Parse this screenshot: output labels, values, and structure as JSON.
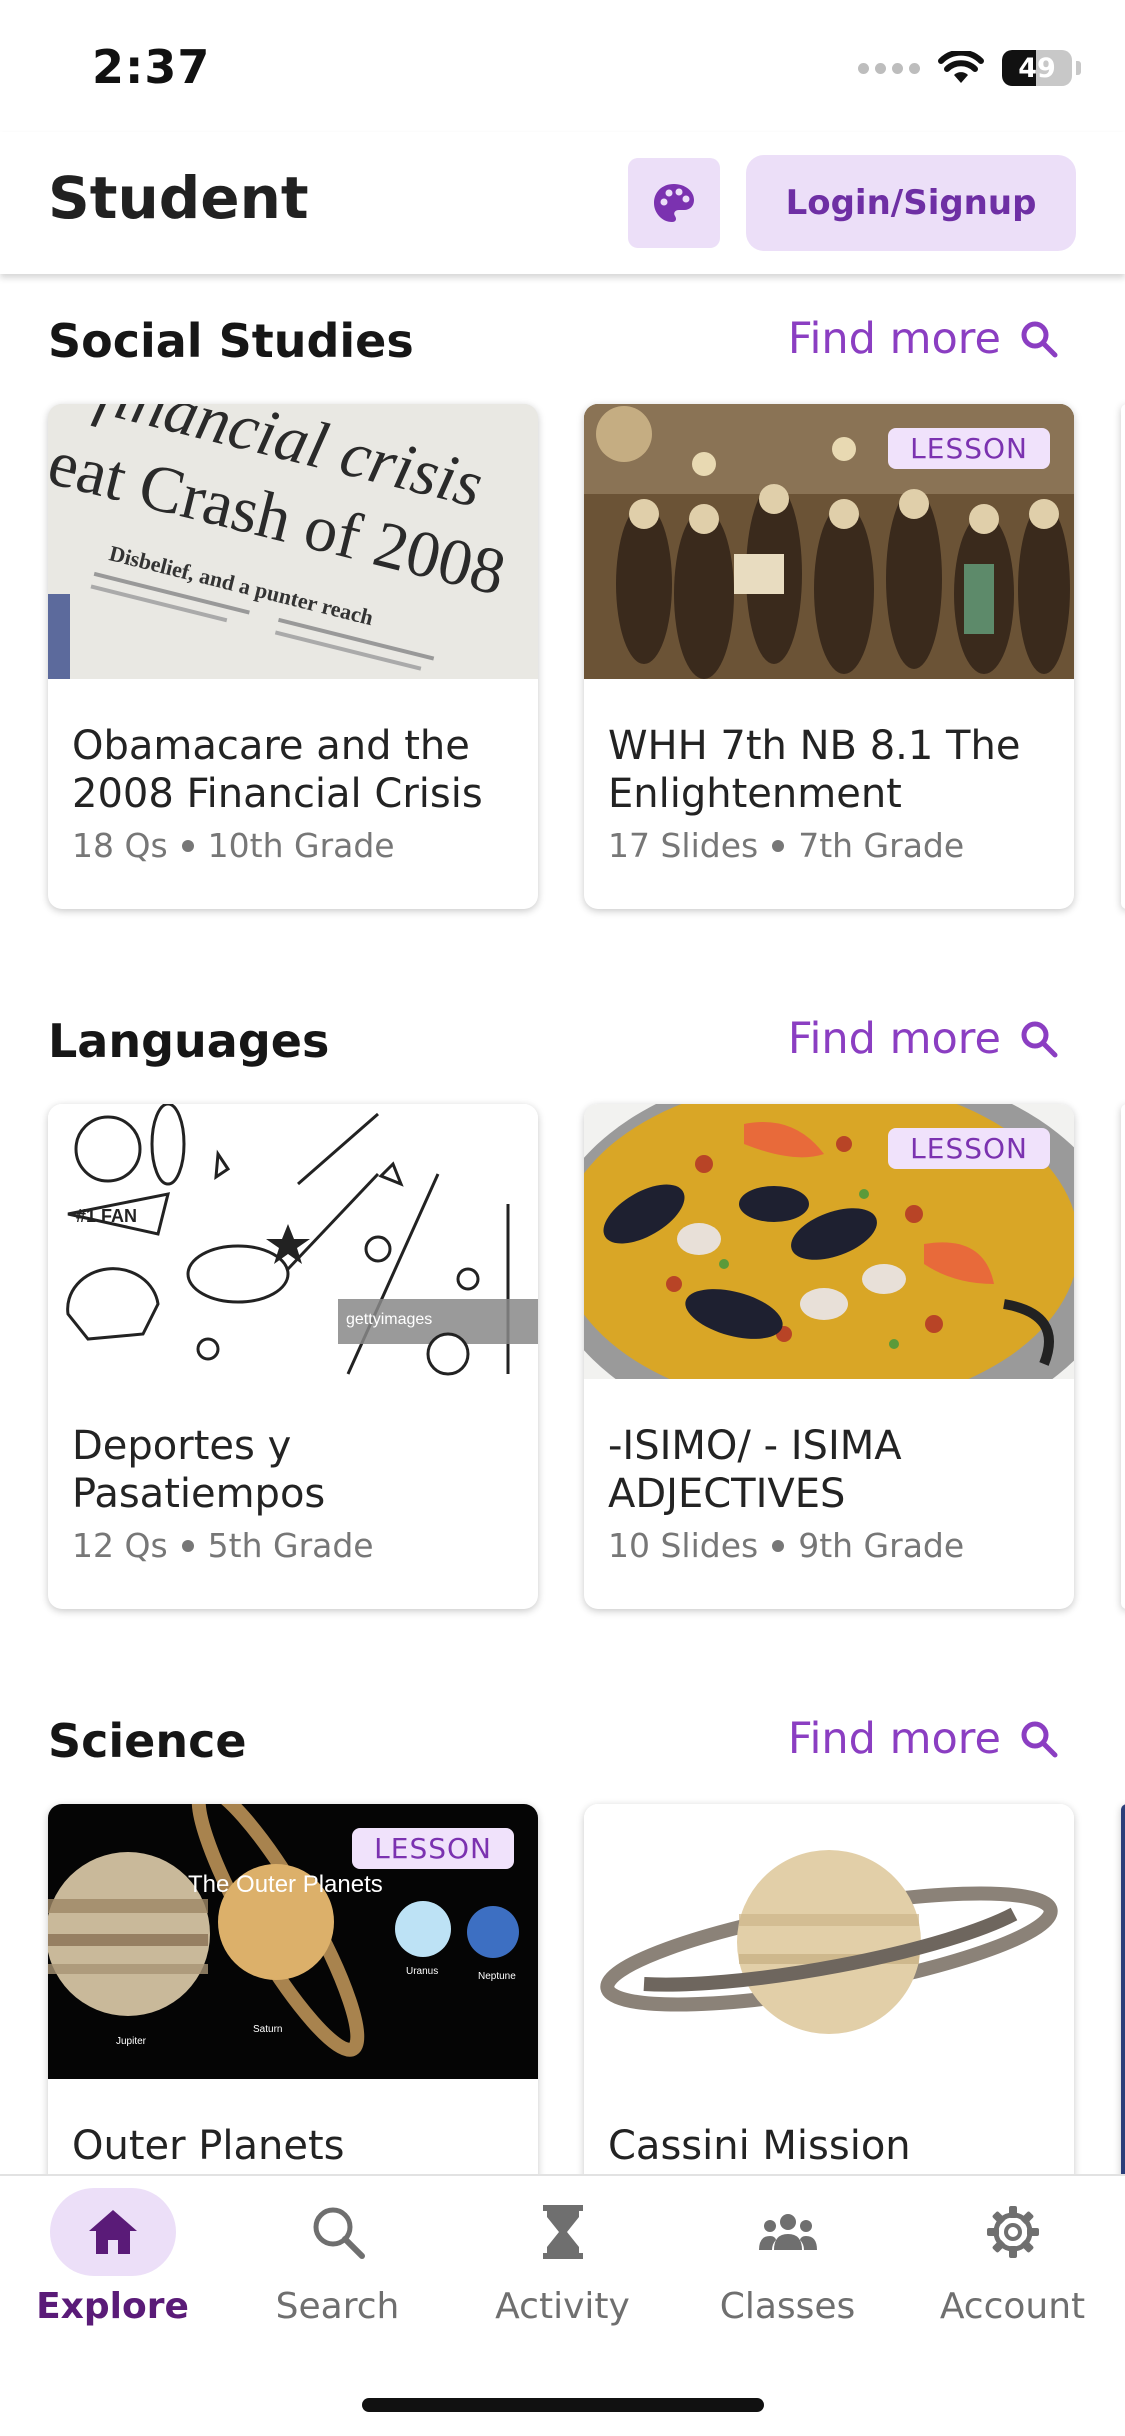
{
  "status_bar": {
    "time": "2:37",
    "battery_percent": "49",
    "battery_level": 0.49
  },
  "header": {
    "title": "Student",
    "theme_icon": "palette-icon",
    "login_label": "Login/Signup"
  },
  "colors": {
    "accent": "#8b3ec2",
    "accent_dark": "#5a1b78",
    "accent_bg": "#ecdff8",
    "badge_text": "#7b32b0"
  },
  "sections": [
    {
      "title": "Social Studies",
      "find_more": "Find more",
      "cards": [
        {
          "title": "Obamacare and the 2008 Financial Crisis",
          "count": "18 Qs",
          "grade": "10th Grade",
          "badge": "",
          "image_text_1": "financial crisis",
          "image_text_2": "eat Crash of 2008",
          "image_text_3": "Disbelief, and a punter reach"
        },
        {
          "title": "WHH 7th NB 8.1 The Enlightenment",
          "count": "17 Slides",
          "grade": "7th Grade",
          "badge": "LESSON"
        }
      ]
    },
    {
      "title": "Languages",
      "find_more": "Find more",
      "cards": [
        {
          "title": "Deportes y Pasatiempos",
          "count": "12 Qs",
          "grade": "5th Grade",
          "badge": "",
          "image_text_1": "#1 FAN",
          "image_text_2": "gettyimages"
        },
        {
          "title": "-ISIMO/ - ISIMA ADJECTIVES",
          "count": "10 Slides",
          "grade": "9th Grade",
          "badge": "LESSON"
        }
      ]
    },
    {
      "title": "Science",
      "find_more": "Find more",
      "cards": [
        {
          "title": "Outer Planets",
          "badge": "LESSON",
          "image_caption": "The Outer Planets",
          "labels": {
            "jupiter": "Jupiter",
            "saturn": "Saturn",
            "uranus": "Uranus",
            "neptune": "Neptune"
          }
        },
        {
          "title": "Cassini Mission",
          "badge": ""
        }
      ]
    }
  ],
  "bottom_nav": [
    {
      "label": "Explore",
      "icon": "home-icon",
      "active": true
    },
    {
      "label": "Search",
      "icon": "search-icon",
      "active": false
    },
    {
      "label": "Activity",
      "icon": "hourglass-icon",
      "active": false
    },
    {
      "label": "Classes",
      "icon": "group-icon",
      "active": false
    },
    {
      "label": "Account",
      "icon": "gear-icon",
      "active": false
    }
  ]
}
